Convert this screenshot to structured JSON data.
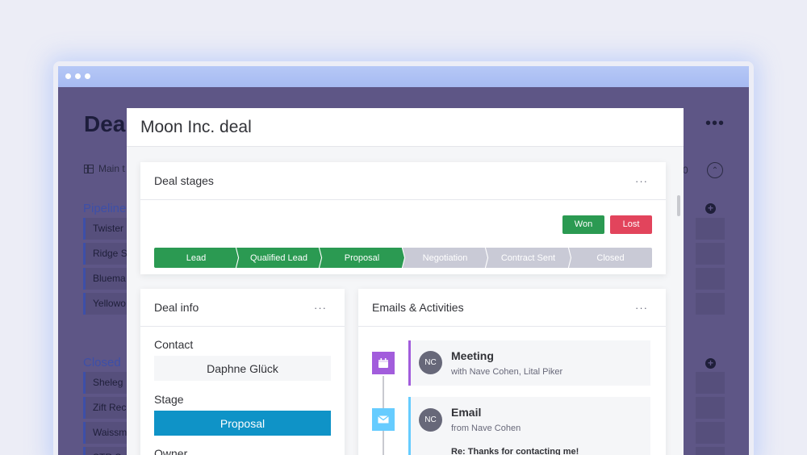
{
  "board": {
    "title": "Deal",
    "more_label": "•••",
    "view_label": "Main t",
    "count_fragment": "0",
    "collapse_icon": "chevron-up-icon",
    "groups": [
      {
        "title": "Pipeline",
        "add_label": "+",
        "rows": [
          "Twister",
          "Ridge S",
          "Bluema",
          "Yellowo"
        ]
      },
      {
        "title": "Closed",
        "add_label": "+",
        "rows": [
          "Sheleg",
          "Zift Rec",
          "Waissm",
          "STR S"
        ]
      }
    ]
  },
  "modal": {
    "title": "Moon Inc. deal",
    "deal_stages": {
      "title": "Deal stages",
      "menu": "···",
      "won_label": "Won",
      "lost_label": "Lost",
      "stages": [
        {
          "label": "Lead",
          "color": "#2b9a52"
        },
        {
          "label": "Qualified Lead",
          "color": "#2b9a52"
        },
        {
          "label": "Proposal",
          "color": "#2b9a52"
        },
        {
          "label": "Negotiation",
          "color": "#c9cad6"
        },
        {
          "label": "Contract Sent",
          "color": "#c9cad6"
        },
        {
          "label": "Closed",
          "color": "#c9cad6"
        }
      ]
    },
    "deal_info": {
      "title": "Deal info",
      "menu": "···",
      "contact_label": "Contact",
      "contact_value": "Daphne Glück",
      "stage_label": "Stage",
      "stage_value": "Proposal",
      "owner_label": "Owner"
    },
    "emails_activities": {
      "title": "Emails & Activities",
      "menu": "···",
      "items": [
        {
          "icon": "calendar-icon",
          "accent": "#a25ddc",
          "avatar": "NC",
          "title": "Meeting",
          "subtitle": "with Nave Cohen, Lital Piker"
        },
        {
          "icon": "mail-icon",
          "accent": "#66ccff",
          "avatar": "NC",
          "title": "Email",
          "subtitle": "from Nave Cohen",
          "body": "Re: Thanks for contacting me!"
        }
      ]
    }
  },
  "colors": {
    "won": "#2b9a52",
    "lost": "#e2445c",
    "stage_value_bg": "#0f93c7",
    "overlay": "#5e5686",
    "accent_blue": "#3d4fa8"
  }
}
